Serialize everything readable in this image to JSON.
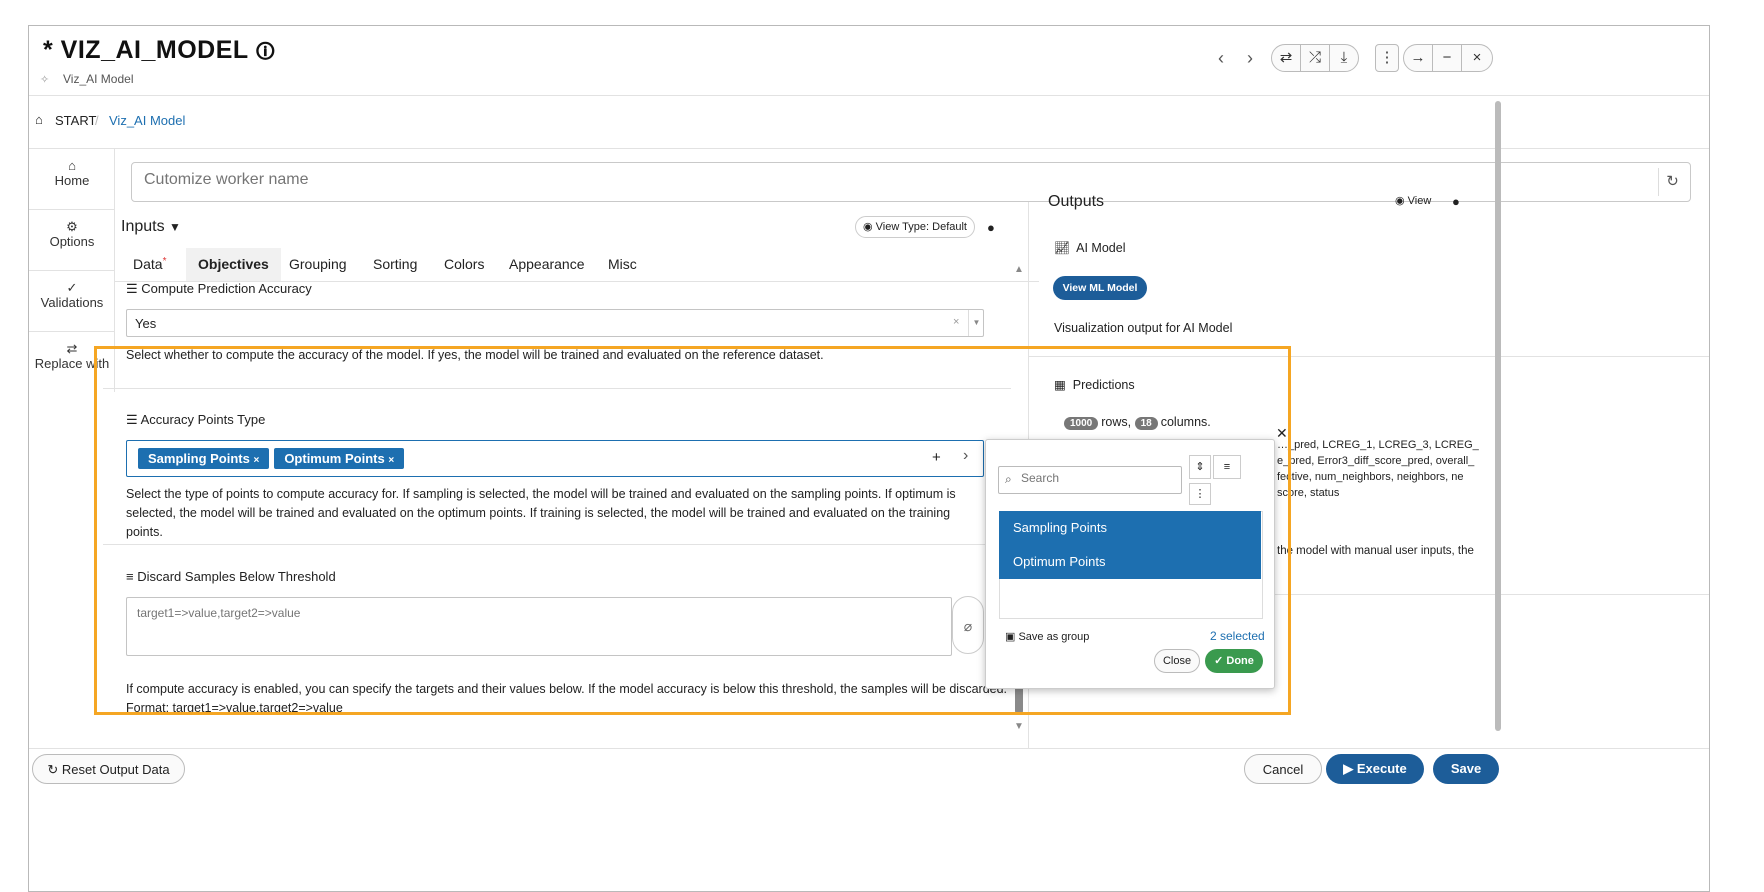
{
  "window": {
    "title": "* VIZ_AI_MODEL",
    "subtitle": "Viz_AI Model",
    "controls": [
      "⇄",
      "⤮",
      "⤓",
      "⋮",
      "→",
      "−",
      "×"
    ]
  },
  "breadcrumb": {
    "home": "START",
    "current": "Viz_AI Model"
  },
  "sidebar": {
    "items": [
      {
        "label": "Home",
        "icon": "home-icon"
      },
      {
        "label": "Options",
        "icon": "gear-icon"
      },
      {
        "label": "Validations",
        "icon": "validations-icon"
      },
      {
        "label": "Replace with",
        "icon": "swap-icon"
      }
    ]
  },
  "worker": {
    "placeholder": "Cutomize worker name"
  },
  "inputs": {
    "title": "Inputs",
    "view_type": "View Type: Default",
    "tabs": [
      "Data",
      "Objectives",
      "Grouping",
      "Sorting",
      "Colors",
      "Appearance",
      "Misc"
    ],
    "active_tab": "Objectives"
  },
  "fields": {
    "compute": {
      "label": "Compute Prediction Accuracy",
      "value": "Yes",
      "help": "Select whether to compute the accuracy of the model. If yes, the model will be trained and evaluated on the reference dataset."
    },
    "points": {
      "label": "Accuracy Points Type",
      "tags": [
        "Sampling Points",
        "Optimum Points"
      ],
      "help": "Select the type of points to compute accuracy for. If sampling is selected, the model will be trained and evaluated on the sampling points. If optimum is selected, the model will be trained and evaluated on the optimum points. If training is selected, the model will be trained and evaluated on the training points."
    },
    "discard": {
      "label": "Discard Samples Below Threshold",
      "placeholder": "target1=>value,target2=>value",
      "help": "If compute accuracy is enabled, you can specify the targets and their values below. If the model accuracy is below this threshold, the samples will be discarded.",
      "format": "Format: target1=>value,target2=>value"
    }
  },
  "outputs": {
    "title": "Outputs",
    "view": "View",
    "ai_model": {
      "title": "AI Model",
      "button": "View ML Model",
      "desc": "Visualization output for AI Model"
    },
    "predictions": {
      "title": "Predictions",
      "rows": "1000",
      "rows_text": "rows,",
      "cols": "18",
      "cols_text": "columns.",
      "col_lines": [
        "…_pred, LCREG_1, LCREG_3, LCREG_",
        "e_pred, Error3_diff_score_pred, overall_",
        "fective, num_neighbors, neighbors, ne",
        "score, status"
      ],
      "desc_fragment": "the model with manual user inputs, the"
    }
  },
  "popup": {
    "search_placeholder": "Search",
    "options": [
      "Sampling Points",
      "Optimum Points"
    ],
    "save_group": "Save as group",
    "selected": "2 selected",
    "close": "Close",
    "done": "Done"
  },
  "footer": {
    "reset": "Reset Output Data",
    "cancel": "Cancel",
    "execute": "Execute",
    "save": "Save"
  }
}
